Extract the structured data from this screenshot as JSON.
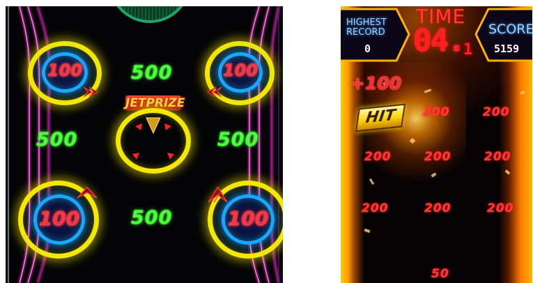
{
  "left_panel": {
    "bumpers": [
      {
        "label": "100"
      },
      {
        "label": "100"
      },
      {
        "label": "100"
      },
      {
        "label": "100"
      }
    ],
    "point_targets": [
      {
        "label": "500"
      },
      {
        "label": "500"
      },
      {
        "label": "500"
      },
      {
        "label": "500"
      }
    ],
    "jet_prize": {
      "label": "JETPRIZE"
    },
    "colors": {
      "neon_pink": "#ff2fd6",
      "neon_cyan": "#19e0ff",
      "ring_yellow": "#f5e800",
      "bumper_red": "#ff3440",
      "target_green": "#4dff3a"
    }
  },
  "right_panel": {
    "hud": {
      "highest_record_label_line1": "HIGHEST",
      "highest_record_label_line2": "RECORD",
      "highest_record_value": "0",
      "time_label": "TIME",
      "time_value": "04.",
      "time_fraction": "1",
      "score_label": "SCORE",
      "score_value": "5159"
    },
    "popup": {
      "bonus": "+100",
      "hit": "HIT"
    },
    "targets": [
      {
        "label": "200"
      },
      {
        "label": "200"
      },
      {
        "label": "200"
      },
      {
        "label": "200"
      },
      {
        "label": "200"
      },
      {
        "label": "200"
      },
      {
        "label": "200"
      },
      {
        "label": "200"
      },
      {
        "label": "50"
      }
    ],
    "colors": {
      "glow_orange": "#ff9d00",
      "target_red": "#ff3434",
      "time_red": "#ff2020"
    }
  }
}
